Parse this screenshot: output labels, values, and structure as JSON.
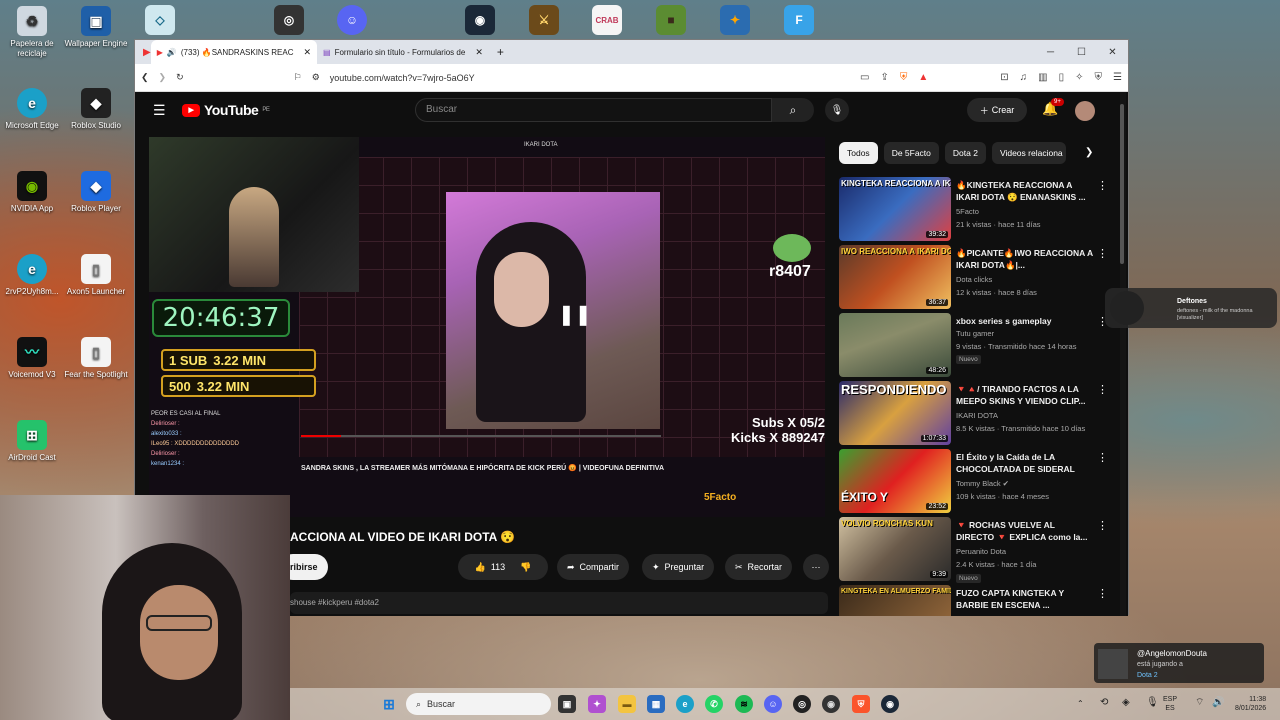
{
  "desktop": {
    "icons": [
      {
        "label": "Papelera de reciclaje",
        "icon": "recycle-bin-icon"
      },
      {
        "label": "Wallpaper Engine",
        "icon": "wallpaper-engine-icon"
      },
      {
        "label": "Microsoft Edge",
        "icon": "edge-icon"
      },
      {
        "label": "Roblox Studio",
        "icon": "roblox-studio-icon"
      },
      {
        "label": "NVIDIA App",
        "icon": "nvidia-icon"
      },
      {
        "label": "Roblox Player",
        "icon": "roblox-player-icon"
      },
      {
        "label": "2rvP2Uyh8m...",
        "icon": "edge-icon"
      },
      {
        "label": "Axon5 Launcher",
        "icon": "file-icon"
      },
      {
        "label": "Voicemod V3",
        "icon": "voicemod-icon"
      },
      {
        "label": "Fear the Spotlight",
        "icon": "file-icon"
      },
      {
        "label": "AirDroid Cast",
        "icon": "airdroid-icon"
      }
    ]
  },
  "browser": {
    "tabs": [
      {
        "label": "(733) 🔥SANDRASKINS REAC"
      },
      {
        "label": "Formulario sin título - Formularios de"
      }
    ],
    "new_tab": "+",
    "url": "youtube.com/watch?v=7wjro-5aO6Y"
  },
  "youtube": {
    "logo": "YouTube",
    "region": "PE",
    "search_placeholder": "Buscar",
    "create": "Crear",
    "notif_count": "9+",
    "player": {
      "timer": "20:46:37",
      "goal1_label": "1 SUB",
      "goal1_value": "3.22 MIN",
      "goal2_label": "500",
      "goal2_value": "3.22 MIN",
      "inner_search": "IKARI DOTA",
      "counter": "r8407",
      "subs": "Subs X 05/2",
      "kicks": "Kicks X 889247",
      "inner_title": "SANDRA SKINS , LA STREAMER MÁS MITÓMANA E HIPÓCRITA DE KICK PERÚ 😡 | VIDEOFUNA DEFINITIVA",
      "channel_overlay": "5Facto",
      "chat": [
        "PEOR ES CASI AL FINAL",
        "Delirioser :",
        "alexito033 :",
        "ILeo95 : XDDDDDDDDDDDDDD",
        "Delirioser :",
        "kenan1234 :"
      ]
    },
    "video_title": "ACCIONA AL VIDEO DE IKARI DOTA 😯",
    "subscribe": "ribirse",
    "likes": "113",
    "share": "Compartir",
    "ask": "Preguntar",
    "clip": "Recortar",
    "description": "shouse #kickperu #dota2",
    "chips": [
      "Todos",
      "De 5Facto",
      "Dota 2",
      "Videos relaciona"
    ],
    "recommendations": [
      {
        "title": "🔥KINGTEKA REACCIONA A IKARI DOTA 😯 ENANASKINS ...",
        "channel": "5Facto",
        "meta": "21 k vistas · hace 11 días",
        "duration": "39:32",
        "thumb_text": "KINGTEKA REACCIONA A IKARI DOTA",
        "badge": ""
      },
      {
        "title": "🔥PICANTE🔥IWO REACCIONA A IKARI DOTA🔥|...",
        "channel": "Dota clicks",
        "meta": "12 k vistas · hace 8 días",
        "duration": "36:37",
        "thumb_text": "IWO REACCIONA A IKARI DOTA",
        "badge": ""
      },
      {
        "title": "xbox series s gameplay",
        "channel": "Tutu gamer",
        "meta": "9 vistas · Transmitido hace 14 horas",
        "duration": "48:26",
        "thumb_text": "",
        "badge": "Nuevo"
      },
      {
        "title": "🔻🔺/ TIRANDO FACTOS A LA MEEPO SKINS Y VIENDO CLIP...",
        "channel": "IKARI DOTA",
        "meta": "8.5 K vistas · Transmitido hace 10 días",
        "duration": "1:07:33",
        "thumb_text": "RESPONDIENDO",
        "badge": ""
      },
      {
        "title": "El Éxito y la Caída de LA CHOCOLATADA DE SIDERAL",
        "channel": "Tommy Black ✔",
        "meta": "109 k vistas · hace 4 meses",
        "duration": "23:52",
        "thumb_text": "ÉXITO Y",
        "badge": ""
      },
      {
        "title": "🔻 ROCHAS VUELVE AL DIRECTO 🔻 EXPLICA como la...",
        "channel": "Peruanito Dota",
        "meta": "2.4 K vistas · hace 1 día",
        "duration": "9:39",
        "thumb_text": "VOLVIO RONCHAS KUN",
        "badge": "Nuevo"
      },
      {
        "title": "FUZO CAPTA KINGTEKA Y BARBIE EN ESCENA ...",
        "channel": "",
        "meta": "",
        "duration": "",
        "thumb_text": "KINGTEKA EN ALMUERZO FAMILIAR",
        "badge": ""
      }
    ]
  },
  "media_widget": {
    "title": "Deftones",
    "subtitle": "deftones - milk of the madonna [visualizer]"
  },
  "steam_notification": {
    "name": "@AngelomonDouta",
    "status": "está jugando a",
    "game": "Dota 2"
  },
  "taskbar": {
    "search": "Buscar",
    "lang_top": "ESP",
    "lang_bottom": "ES",
    "time": "11:38",
    "date": "8/01/2026"
  }
}
